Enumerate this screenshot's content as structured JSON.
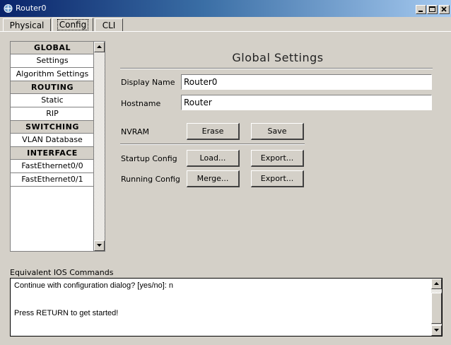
{
  "window": {
    "title": "Router0"
  },
  "tabs": [
    {
      "label": "Physical"
    },
    {
      "label": "Config"
    },
    {
      "label": "CLI"
    }
  ],
  "sidebar": {
    "sections": [
      {
        "title": "GLOBAL",
        "items": [
          "Settings",
          "Algorithm Settings"
        ]
      },
      {
        "title": "ROUTING",
        "items": [
          "Static",
          "RIP"
        ]
      },
      {
        "title": "SWITCHING",
        "items": [
          "VLAN Database"
        ]
      },
      {
        "title": "INTERFACE",
        "items": [
          "FastEthernet0/0",
          "FastEthernet0/1"
        ]
      }
    ]
  },
  "main": {
    "title": "Global Settings",
    "display_name_label": "Display Name",
    "display_name_value": "Router0",
    "hostname_label": "Hostname",
    "hostname_value": "Router",
    "nvram_label": "NVRAM",
    "erase_label": "Erase",
    "save_label": "Save",
    "startup_label": "Startup Config",
    "load_label": "Load...",
    "export_startup_label": "Export...",
    "running_label": "Running Config",
    "merge_label": "Merge...",
    "export_running_label": "Export..."
  },
  "ios": {
    "label": "Equivalent IOS Commands",
    "lines": [
      "Continue with configuration dialog? [yes/no]: n",
      "",
      "Press RETURN to get started!"
    ]
  }
}
